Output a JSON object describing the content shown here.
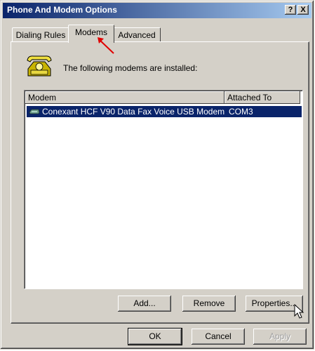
{
  "window": {
    "title": "Phone And Modem Options",
    "help_label": "?",
    "close_label": "X"
  },
  "tabs": [
    {
      "label": "Dialing Rules",
      "selected": false
    },
    {
      "label": "Modems",
      "selected": true
    },
    {
      "label": "Advanced",
      "selected": false
    }
  ],
  "modems_tab": {
    "intro_text": "The following modems are installed:",
    "columns": [
      "Modem",
      "Attached To"
    ],
    "rows": [
      {
        "modem": "Conexant HCF V90 Data Fax Voice USB Modem",
        "attached_to": "COM3",
        "selected": true
      }
    ],
    "buttons": {
      "add": "Add...",
      "remove": "Remove",
      "properties": "Properties..."
    }
  },
  "footer": {
    "ok": "OK",
    "cancel": "Cancel",
    "apply": "Apply"
  },
  "colors": {
    "titlebar": "#0a246a",
    "selection": "#0a246a",
    "face": "#d4d0c8",
    "annotation": "#e00000"
  },
  "icons": [
    "phone-icon",
    "modem-icon",
    "help-icon",
    "close-icon",
    "mouse-cursor-icon",
    "annotation-arrow-icon"
  ]
}
